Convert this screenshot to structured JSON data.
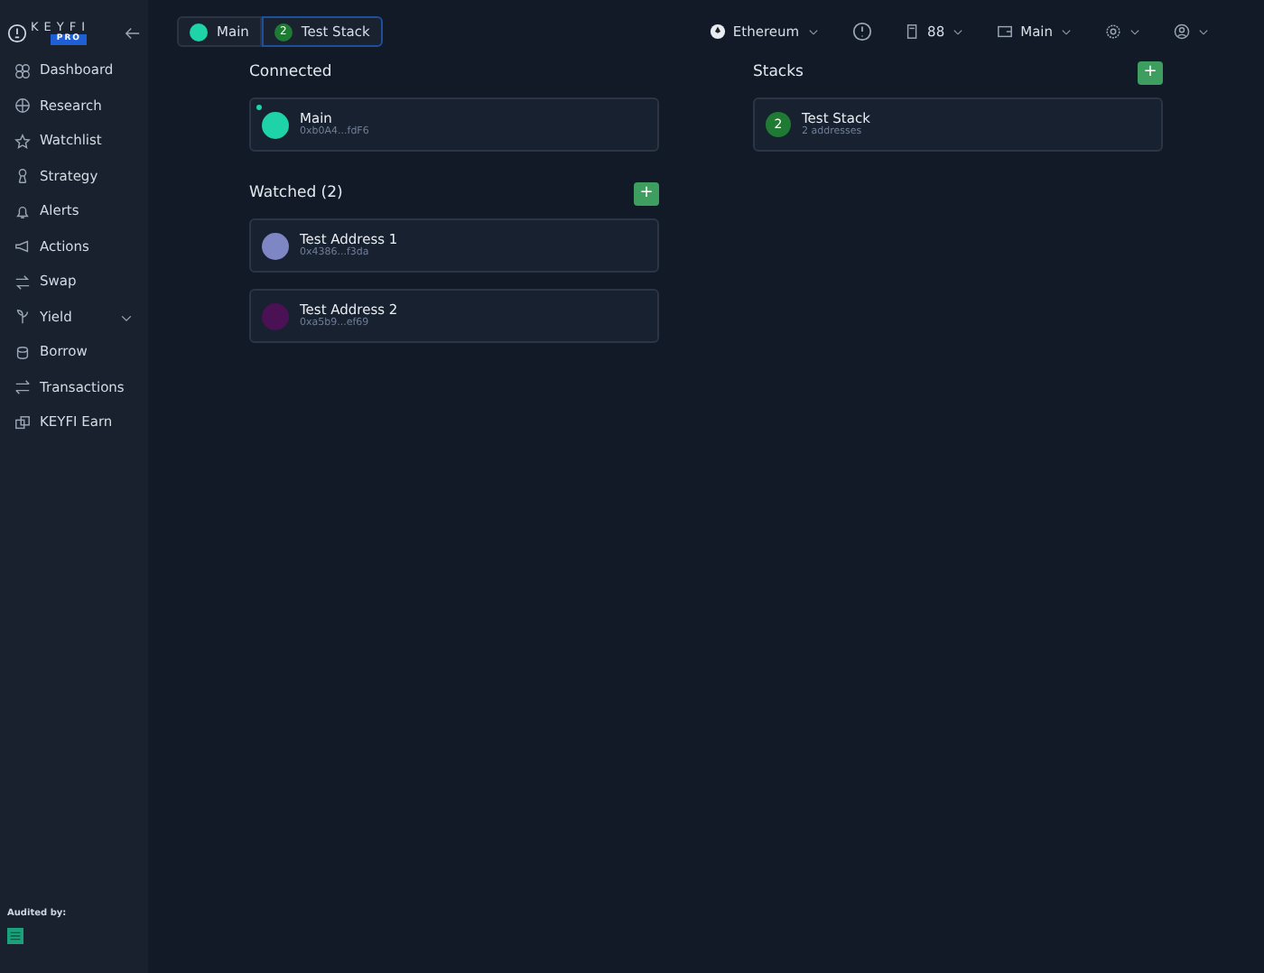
{
  "logo": {
    "name": "KEYFI",
    "badge": "PRO"
  },
  "sidebar": {
    "items": [
      {
        "label": "Dashboard"
      },
      {
        "label": "Research"
      },
      {
        "label": "Watchlist"
      },
      {
        "label": "Strategy"
      },
      {
        "label": "Alerts"
      },
      {
        "label": "Actions"
      },
      {
        "label": "Swap"
      },
      {
        "label": "Yield",
        "expandable": true
      },
      {
        "label": "Borrow"
      },
      {
        "label": "Transactions"
      },
      {
        "label": "KEYFI Earn"
      }
    ],
    "audited_label": "Audited by:"
  },
  "tabs": [
    {
      "label": "Main",
      "kind": "dot",
      "color": "#1fd3a8",
      "selected": false
    },
    {
      "label": "Test Stack",
      "kind": "count",
      "count": "2",
      "selected": true
    }
  ],
  "topbar": {
    "network": "Ethereum",
    "gas": "88",
    "wallet": "Main"
  },
  "connected": {
    "title": "Connected",
    "items": [
      {
        "name": "Main",
        "address": "0xb0A4...fdF6",
        "color": "#1fd3a8",
        "online": true
      }
    ]
  },
  "watched": {
    "title": "Watched (2)",
    "add": "+",
    "items": [
      {
        "name": "Test Address 1",
        "address": "0x4386...f3da",
        "color": "#7f86c4"
      },
      {
        "name": "Test Address 2",
        "address": "0xa5b9...ef69",
        "color": "#4a1254"
      }
    ]
  },
  "stacks": {
    "title": "Stacks",
    "add": "+",
    "items": [
      {
        "name": "Test Stack",
        "count": "2",
        "subtitle": "2 addresses"
      }
    ]
  }
}
